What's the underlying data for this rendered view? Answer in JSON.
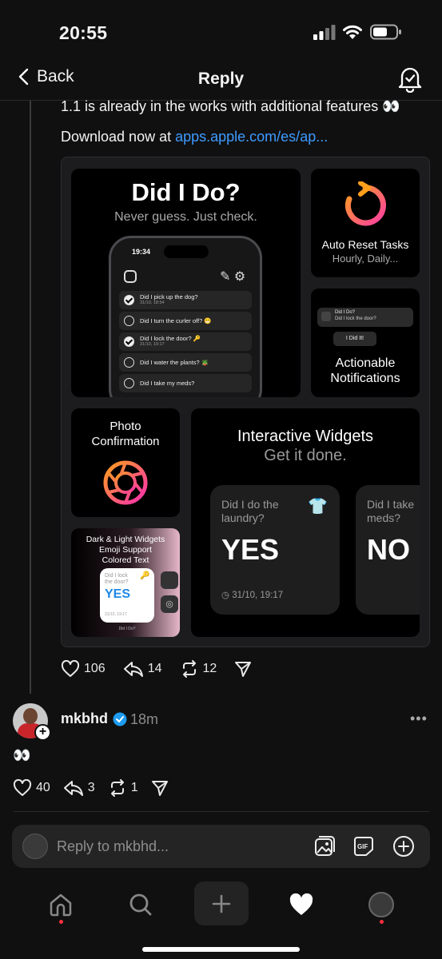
{
  "status_bar": {
    "time": "20:55"
  },
  "header": {
    "back_label": "Back",
    "title": "Reply"
  },
  "post": {
    "text_line1": "1.1 is already in the works with additional features 👀",
    "text_line2_prefix": "Download now at ",
    "link_text": "apps.apple.com/es/ap...",
    "likes": "106",
    "replies": "14",
    "reposts": "12"
  },
  "media": {
    "main": {
      "title": "Did I Do?",
      "subtitle": "Never guess. Just check."
    },
    "phone": {
      "time": "19:34",
      "rows": [
        {
          "text": "Did I pick up the dog?",
          "date": "31/10, 18:54",
          "done": true
        },
        {
          "text": "Did I turn the curler off? 😬",
          "date": "",
          "done": false
        },
        {
          "text": "Did I lock the door? 🔑",
          "date": "31/10, 19:17",
          "done": true
        },
        {
          "text": "Did I water the plants? 🪴",
          "date": "",
          "done": false
        },
        {
          "text": "Did I take my meds?",
          "date": "",
          "done": false
        }
      ]
    },
    "auto_reset": {
      "title": "Auto Reset Tasks",
      "subtitle": "Hourly, Daily..."
    },
    "notifications": {
      "title_line1": "Actionable",
      "title_line2": "Notifications",
      "banner_title": "Did I Do?",
      "banner_body": "Did I lock the door?",
      "action": "I Did It!"
    },
    "photo": {
      "title_line1": "Photo",
      "title_line2": "Confirmation"
    },
    "widgets": {
      "title": "Interactive Widgets",
      "subtitle": "Get it done.",
      "card1": {
        "question_line1": "Did I do the",
        "question_line2": "laundry?",
        "answer": "YES",
        "date": "31/10, 19:17",
        "emoji": "👕"
      },
      "card2": {
        "question_line1": "Did I take",
        "question_line2": "meds?",
        "answer": "NO"
      }
    },
    "dark_light": {
      "line1": "Dark & Light Widgets",
      "line2": "Emoji Support",
      "line3": "Colored Text",
      "mini_question_line1": "Did I lock",
      "mini_question_line2": "the door?",
      "mini_answer": "YES",
      "mini_date": "31/10, 19:17",
      "mini_footer": "Did I Do?"
    }
  },
  "reply": {
    "username": "mkbhd",
    "time_ago": "18m",
    "text": "👀",
    "likes": "40",
    "replies": "3",
    "reposts": "1"
  },
  "composer": {
    "placeholder": "Reply to mkbhd..."
  },
  "colors": {
    "background": "#101010",
    "link": "#3e9bff",
    "verified": "#1d9bf0",
    "notification_dot": "#ff3040"
  }
}
